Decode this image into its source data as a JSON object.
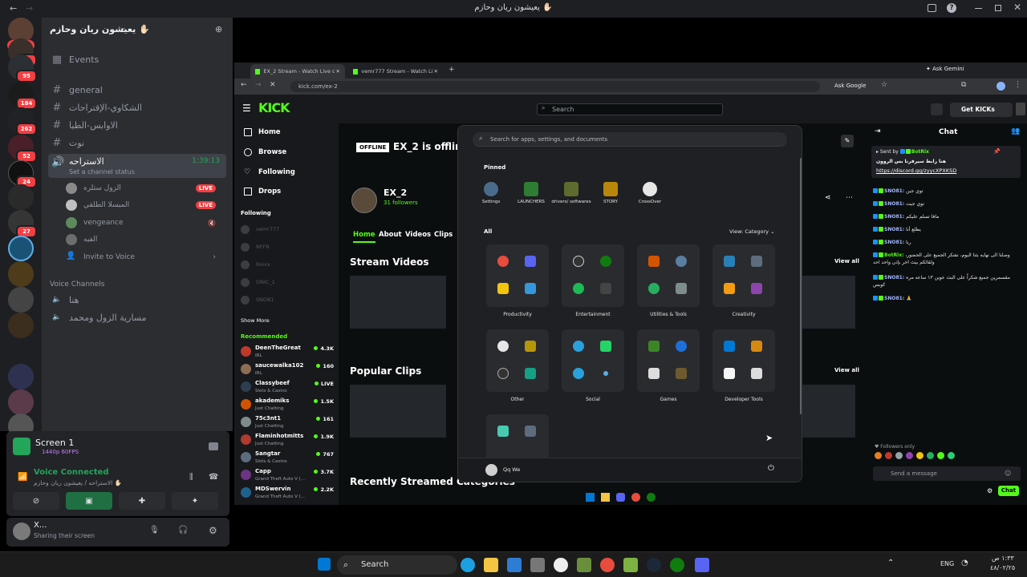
{
  "window": {
    "title": "يعيشون ريان وحازم ✋🏻"
  },
  "rail": {
    "new_label": "NEW",
    "badges": [
      "25",
      "95",
      "184",
      "262",
      "52",
      "24",
      "27"
    ]
  },
  "server": {
    "name": "يعيشون ريان وحازم ✋🏻",
    "events_label": "Events",
    "channels": [
      "general",
      "الشكاوي-الإقتراحات",
      "الاوابس-الطيا",
      "نوت"
    ],
    "voice_active": {
      "name": "الاستراحه",
      "timer": "1:39:13",
      "status": "Set a channel status"
    },
    "voice_users": [
      {
        "name": "الزول ستلره",
        "live": "LIVE"
      },
      {
        "name": "المبسلا الطلقي",
        "live": "LIVE"
      },
      {
        "name": "vengeance",
        "live": ""
      },
      {
        "name": "الفيه",
        "live": ""
      }
    ],
    "invite_label": "Invite to Voice",
    "voice_section_label": "Voice Channels",
    "voice_channels": [
      "هنا",
      "مسارية الزول ومحمد"
    ]
  },
  "voice_panel": {
    "screen_title": "Screen 1",
    "screen_sub": "1440p 60FPS",
    "connected_label": "Voice Connected",
    "connected_sub": "الاستراحه / يعيشون ريان وحازم ✋🏻"
  },
  "user": {
    "name": "X...",
    "status": "Sharing their screen"
  },
  "chrome": {
    "tabs": [
      "EX_2 Stream - Watch Live on Ki",
      "vemr777 Stream - Watch Live o"
    ],
    "url": "kick.com/ex-2",
    "ask_gemini": "Ask Gemini",
    "ask_google": "Ask Google"
  },
  "kick": {
    "search_placeholder": "Search",
    "get_kicks": "Get KICKs",
    "nav": [
      "Home",
      "Browse",
      "Following",
      "Drops"
    ],
    "following_label": "Following",
    "following": [
      "vemr777",
      "NFFR",
      "Roivx",
      "ONIC_1",
      "SNO81"
    ],
    "show_more": "Show More",
    "recommended_label": "Recommended",
    "recommended": [
      {
        "name": "DeenTheGreat",
        "cat": "IRL",
        "viewers": "4.3K",
        "color": "#c0392b"
      },
      {
        "name": "saucewalka102",
        "cat": "IRL",
        "viewers": "160",
        "color": "#8e6e53"
      },
      {
        "name": "Classybeef",
        "cat": "Slots & Casino",
        "viewers": "LIVE",
        "color": "#2c3e50"
      },
      {
        "name": "akademiks",
        "cat": "Just Chatting",
        "viewers": "1.5K",
        "color": "#d35400"
      },
      {
        "name": "75c3nt1",
        "cat": "Just Chatting",
        "viewers": "161",
        "color": "#7f8c8d"
      },
      {
        "name": "Flaminhotmitts",
        "cat": "Just Chatting",
        "viewers": "1.9K",
        "color": "#b03a2e"
      },
      {
        "name": "Sangtar",
        "cat": "Slots & Casino",
        "viewers": "767",
        "color": "#5d6d7e"
      },
      {
        "name": "Capp",
        "cat": "Grand Theft Auto V (...",
        "viewers": "3.7K",
        "color": "#6c3483"
      },
      {
        "name": "MDSwervin",
        "cat": "Grand Theft Auto V (...",
        "viewers": "2.2K",
        "color": "#1f618d"
      }
    ],
    "offline_badge": "OFFLINE",
    "offline_text": "EX_2 is offline",
    "channel_name": "EX_2",
    "followers": "31 followers",
    "tabs": [
      "Home",
      "About",
      "Videos",
      "Clips"
    ],
    "stream_videos": "Stream Videos",
    "popular_clips": "Popular Clips",
    "recent_categories": "Recently Streamed Categories",
    "view_all": "View all",
    "chat_title": "Chat",
    "pinned_sent_by": "Sent by",
    "pinned_user": "BotRix",
    "pinned_text": "هنا رابط سيرفرنا بس الروون",
    "pinned_link": "https://discord.gg/zyycXPXKSD",
    "messages": [
      {
        "user": "SNO81:",
        "text": "توي جين"
      },
      {
        "user": "SNO81:",
        "text": "توي جيت"
      },
      {
        "user": "SNO81:",
        "text": "مافا تسلم عليكم"
      },
      {
        "user": "SNO81:",
        "text": "يطلع أنا"
      },
      {
        "user": "SNO81:",
        "text": "ربا"
      },
      {
        "user": "BotRix:",
        "text": "وصلنا الى نهايه بثنا اليوم، نشكر الجميع على الحضور، ولقائكم بيث اخر بإذن واحد احد"
      },
      {
        "user": "SNO81:",
        "text": "مقسمرين جميع شكراً على البث عوين ١٣ ساعه مره كويس"
      },
      {
        "user": "SNO81:",
        "text": "🙏"
      }
    ],
    "followers_only": "Followers only",
    "send_placeholder": "Send a message",
    "chat_button": "Chat"
  },
  "start_menu": {
    "search_placeholder": "Search for apps, settings, and documents",
    "pinned_label": "Pinned",
    "pinned": [
      "Settings",
      "LAUNCHERS",
      "drivers/ softwares",
      "STORY",
      "CrossOver"
    ],
    "all_label": "All",
    "view_label": "View: Category",
    "categories": [
      "Productivity",
      "Entertainment",
      "Utilities & Tools",
      "Creativity",
      "Other",
      "Social",
      "Games",
      "Developer Tools"
    ],
    "user_name": "Qq We"
  },
  "taskbar": {
    "search_label": "Search",
    "lang": "ENG",
    "time": "١:٣٣ ص",
    "date": "٤٨/٠٢/٢٥"
  }
}
